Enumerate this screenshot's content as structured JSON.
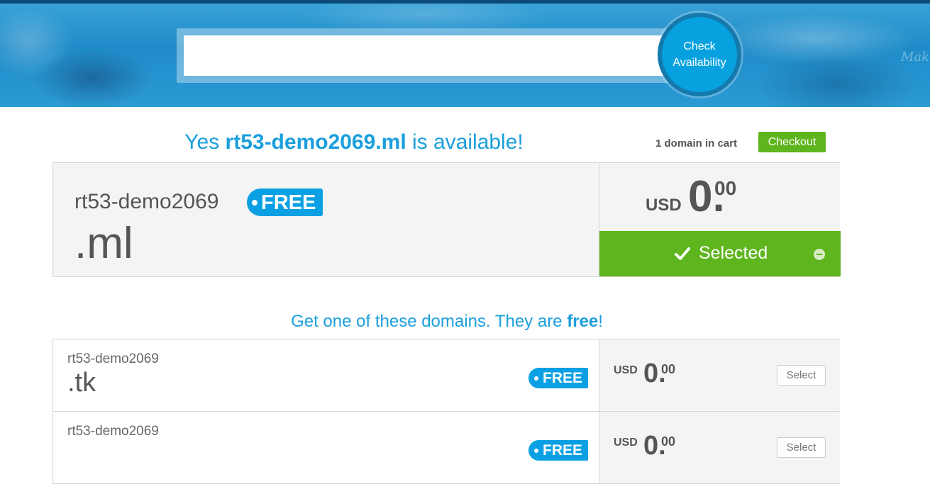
{
  "colors": {
    "accent_blue": "#1a9fdc",
    "badge_blue": "#0aa0e3",
    "success_green": "#5fb51d",
    "hero_blue": "#1f8cc9"
  },
  "hero": {
    "search_value": "",
    "search_placeholder": "",
    "check_button_line1": "Check",
    "check_button_line2": "Availability",
    "watermark_text": "Mak"
  },
  "availability": {
    "prefix": "Yes ",
    "domain": "rt53-demo2069.ml",
    "suffix": " is available!"
  },
  "cart": {
    "count_text": "1 domain in cart",
    "checkout_label": "Checkout"
  },
  "main_result": {
    "sld": "rt53-demo2069",
    "tld": ".ml",
    "badge": "FREE",
    "currency": "USD",
    "price_int": "0.",
    "price_dec": "00",
    "selected_label": "Selected",
    "icons": [
      "check-icon",
      "minus-circle-icon"
    ]
  },
  "suggestions": {
    "title_prefix": "Get one of these domains. They are ",
    "title_bold": "free",
    "title_suffix": "!",
    "items": [
      {
        "sld": "rt53-demo2069",
        "tld": ".tk",
        "badge": "FREE",
        "currency": "USD",
        "price_int": "0.",
        "price_dec": "00",
        "select_label": "Select"
      },
      {
        "sld": "rt53-demo2069",
        "tld": "",
        "badge": "FREE",
        "currency": "USD",
        "price_int": "0.",
        "price_dec": "00",
        "select_label": "Select"
      }
    ]
  }
}
